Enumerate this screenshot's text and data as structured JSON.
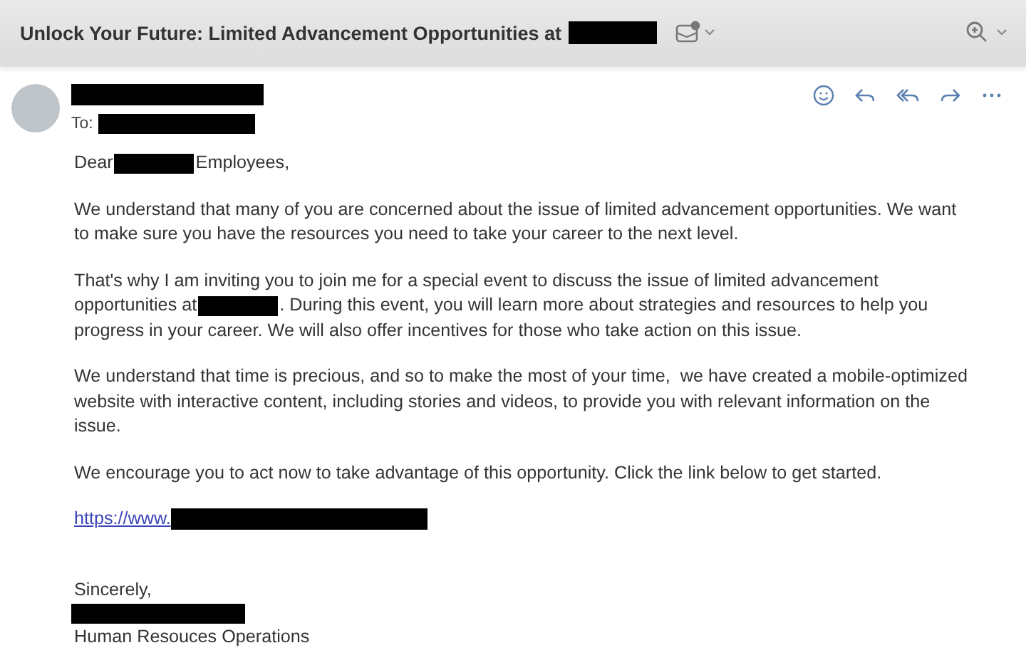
{
  "subject": {
    "text": "Unlock Your Future: Limited Advancement Opportunities at",
    "redacted": true
  },
  "sender": {
    "name_redacted": true,
    "to_label": "To:",
    "to_redacted": true
  },
  "body": {
    "paragraphs": [
      {
        "lines": [
          [
            {
              "kind": "text",
              "text": "Dear"
            },
            {
              "kind": "redacted"
            },
            {
              "kind": "text",
              "text": "Employees,"
            }
          ]
        ]
      },
      {
        "lines": [
          [
            {
              "kind": "text",
              "text": "We understand that many of you are concerned about the issue of limited advancement opportunities. We want"
            }
          ],
          [
            {
              "kind": "text",
              "text": "to make sure you have the resources you need to take your career to the next level."
            }
          ]
        ]
      },
      {
        "lines": [
          [
            {
              "kind": "text",
              "text": "That's why I am inviting you to join me for a special event to discuss the issue of limited advancement"
            }
          ],
          [
            {
              "kind": "text",
              "text": "opportunities at"
            },
            {
              "kind": "redacted"
            },
            {
              "kind": "text",
              "text": ". During this event, you will learn more about strategies and resources to help you"
            }
          ],
          [
            {
              "kind": "text",
              "text": "progress in your career. We will also offer incentives for those who take action on this issue."
            }
          ]
        ]
      },
      {
        "lines": [
          [
            {
              "kind": "text",
              "text": "We understand that time is precious, and so to make the most of your time,  we have created a mobile-optimized"
            }
          ],
          [
            {
              "kind": "text",
              "text": "website with interactive content, including stories and videos, to provide you with relevant information on the"
            }
          ],
          [
            {
              "kind": "text",
              "text": "issue."
            }
          ]
        ]
      },
      {
        "lines": [
          [
            {
              "kind": "text",
              "text": "We encourage you to act now to take advantage of this opportunity. Click the link below to get started."
            }
          ]
        ]
      }
    ],
    "link": {
      "text": "https://www.",
      "redacted": true
    },
    "closing": "Sincerely,",
    "signature_redacted": true,
    "department": "Human Resouces Operations"
  }
}
